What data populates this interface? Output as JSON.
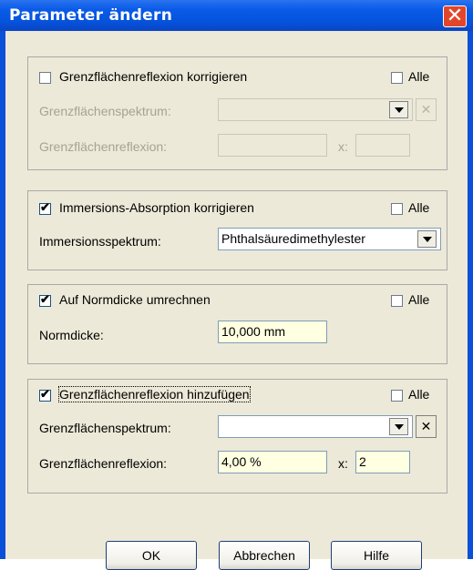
{
  "window": {
    "title": "Parameter ändern",
    "close_symbol": "✕"
  },
  "common": {
    "alle_label": "Alle",
    "x_label": "x:",
    "check_mark": "✔",
    "clear_symbol": "✕"
  },
  "section1": {
    "checkbox_label": "Grenzflächenreflexion korrigieren",
    "checked": false,
    "alle_checked": false,
    "spectrum_label": "Grenzflächenspektrum:",
    "spectrum_value": "",
    "reflexion_label": "Grenzflächenreflexion:",
    "reflexion_value": "",
    "x_value": ""
  },
  "section2": {
    "checkbox_label": "Immersions-Absorption korrigieren",
    "checked": true,
    "alle_checked": false,
    "spectrum_label": "Immersionsspektrum:",
    "spectrum_value": "Phthalsäuredimethylester"
  },
  "section3": {
    "checkbox_label": "Auf Normdicke umrechnen",
    "checked": true,
    "alle_checked": false,
    "normdicke_label": "Normdicke:",
    "normdicke_value": "10,000 mm"
  },
  "section4": {
    "checkbox_label": "Grenzflächenreflexion hinzufügen",
    "checked": true,
    "alle_checked": false,
    "spectrum_label": "Grenzflächenspektrum:",
    "spectrum_value": "",
    "reflexion_label": "Grenzflächenreflexion:",
    "reflexion_value": "4,00 %",
    "x_value": "2"
  },
  "buttons": {
    "ok": "OK",
    "cancel": "Abbrechen",
    "help": "Hilfe"
  }
}
